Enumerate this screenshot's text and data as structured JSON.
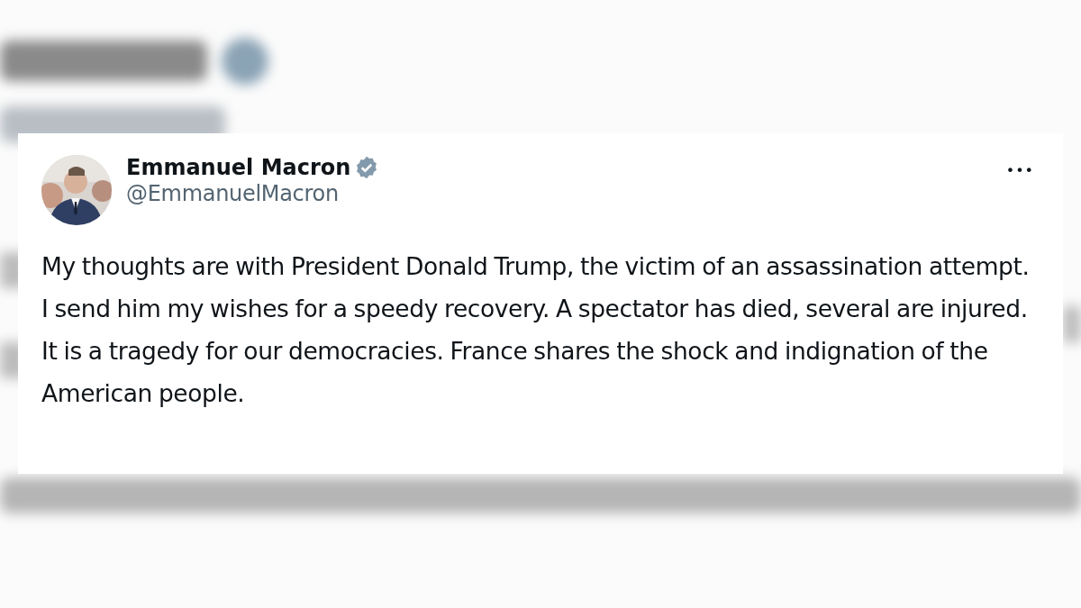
{
  "post": {
    "author": {
      "name": "Emmanuel Macron",
      "verified": true,
      "handle": "@EmmanuelMacron"
    },
    "menu": "•••",
    "text": "My thoughts are with President Donald Trump, the victim of an assassination attempt. I send him my wishes for a speedy recovery. A spectator has died, several are injured. It is a tragedy for our democracies. France shares the shock and indignation of the American people."
  }
}
